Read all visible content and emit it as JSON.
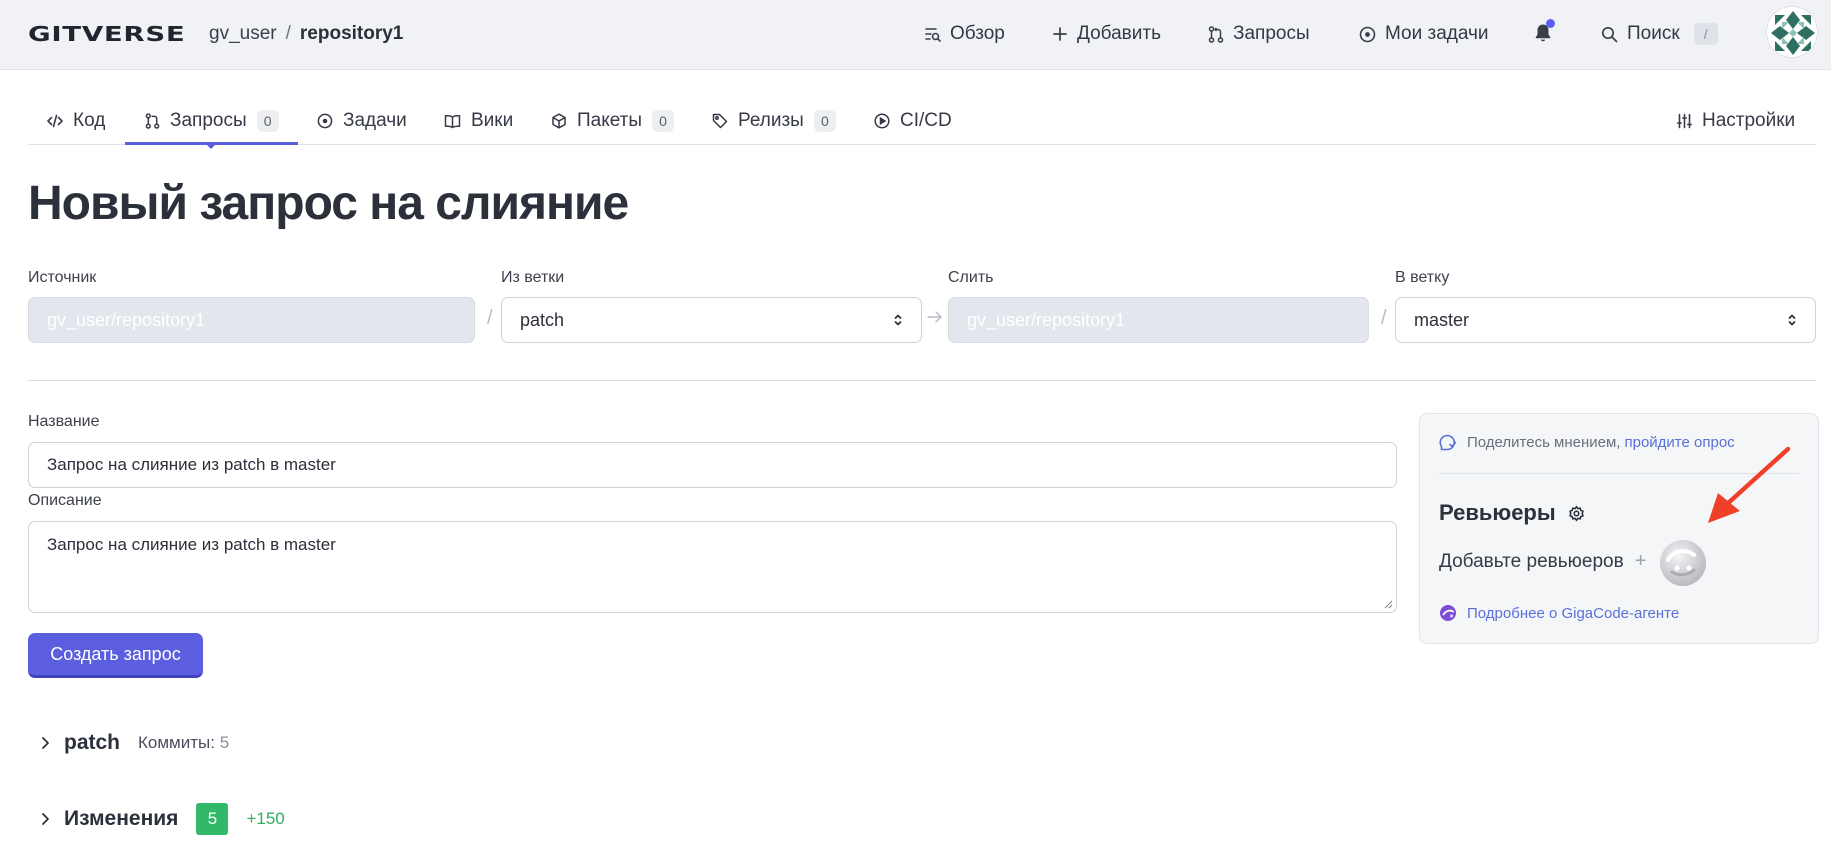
{
  "header": {
    "logo": "GITVERSE",
    "breadcrumb": {
      "user": "gv_user",
      "separator": "/",
      "repo": "repository1"
    },
    "nav": {
      "overview": "Обзор",
      "add": "Добавить",
      "requests": "Запросы",
      "my_tasks": "Мои задачи",
      "search": "Поиск",
      "search_shortcut": "/"
    },
    "notification_dot_color": "#5b5ef0"
  },
  "tabs": {
    "code": "Код",
    "requests": {
      "label": "Запросы",
      "count": "0"
    },
    "tasks": "Задачи",
    "wiki": "Вики",
    "packages": {
      "label": "Пакеты",
      "count": "0"
    },
    "releases": {
      "label": "Релизы",
      "count": "0"
    },
    "cicd": "CI/CD",
    "settings": "Настройки",
    "active": "requests"
  },
  "page": {
    "title": "Новый запрос на слияние"
  },
  "branches": {
    "source_label": "Источник",
    "source_value": "gv_user/repository1",
    "from_branch_label": "Из ветки",
    "from_branch_value": "patch",
    "merge_label": "Слить",
    "merge_value": "gv_user/repository1",
    "into_branch_label": "В ветку",
    "into_branch_value": "master",
    "separator": "/"
  },
  "form": {
    "title_label": "Название",
    "title_value": "Запрос на слияние из patch в master",
    "description_label": "Описание",
    "description_value": "Запрос на слияние из patch в master",
    "submit_label": "Создать запрос",
    "accent_color": "#5b5ede"
  },
  "reviewers_panel": {
    "feedback_text": "Поделитесь мнением,",
    "feedback_link": "пройдите опрос",
    "title": "Ревьюеры",
    "add_text": "Добавьте ревьюеров",
    "add_plus": "+",
    "gigacode_link": "Подробнее о GigaCode-агенте"
  },
  "commits_section": {
    "branch": "patch",
    "label": "Коммиты:",
    "count": "5"
  },
  "changes_section": {
    "label": "Изменения",
    "files_count": "5",
    "additions": "+150",
    "badge_color": "#33b86a"
  }
}
